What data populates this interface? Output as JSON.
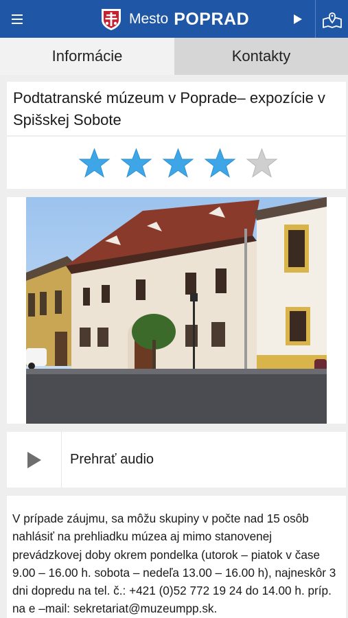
{
  "header": {
    "brand_prefix": "Mesto",
    "brand_name": "POPRAD"
  },
  "tabs": [
    {
      "label": "Informácie",
      "selected": true
    },
    {
      "label": "Kontakty",
      "selected": false
    }
  ],
  "poi": {
    "title": "Podtatranské múzeum v Poprade– expozície v Spišskej Sobote",
    "rating": 4,
    "rating_max": 5,
    "audio_label": "Prehrať audio",
    "description": "V prípade záujmu, sa môžu skupiny v počte nad 15 osôb nahlásiť na prehliadku múzea aj mimo stanovenej prevádzkovej doby okrem pondelka (utorok – piatok v čase 9.00 – 16.00 h. sobota – nedeľa 13.00 – 16.00 h), najneskôr 3 dni dopredu na tel. č.: +421 (0)52 772 19 24 do 14.00 h. príp. na e –mail: sekretariat@muzeumpp.sk."
  },
  "colors": {
    "header_bg": "#1f56a6",
    "star_filled": "#3ea6e6",
    "star_empty": "#cfcfcf"
  },
  "icons": {
    "menu": "hamburger-icon",
    "play": "play-icon",
    "map": "map-pin-icon",
    "star": "star-icon"
  }
}
